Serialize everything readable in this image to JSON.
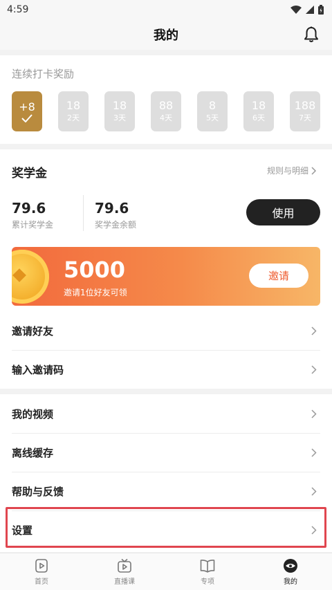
{
  "status": {
    "time": "4:59"
  },
  "header": {
    "title": "我的"
  },
  "checkin": {
    "label": "连续打卡奖励",
    "days": [
      {
        "points": "+8",
        "label": "",
        "active": true
      },
      {
        "points": "18",
        "label": "2天",
        "active": false
      },
      {
        "points": "18",
        "label": "3天",
        "active": false
      },
      {
        "points": "88",
        "label": "4天",
        "active": false
      },
      {
        "points": "8",
        "label": "5天",
        "active": false
      },
      {
        "points": "18",
        "label": "6天",
        "active": false
      },
      {
        "points": "188",
        "label": "7天",
        "active": false
      }
    ]
  },
  "scholarship": {
    "title": "奖学金",
    "rules_link": "规则与明细",
    "total_value": "79.6",
    "total_caption": "累计奖学金",
    "balance_value": "79.6",
    "balance_caption": "奖学金余额",
    "use_button": "使用",
    "invite_banner": {
      "amount": "5000",
      "description": "邀请1位好友可领",
      "button": "邀请"
    }
  },
  "menu": {
    "invite_friends": "邀请好友",
    "enter_code": "输入邀请码",
    "my_videos": "我的视频",
    "offline_cache": "离线缓存",
    "help_feedback": "帮助与反馈",
    "settings": "设置"
  },
  "tabbar": {
    "home": "首页",
    "live": "直播课",
    "topics": "专项",
    "mine": "我的"
  },
  "colors": {
    "accent_gold": "#b98b3e",
    "banner_start": "#f26a3d",
    "banner_end": "#f7b667",
    "highlight_red": "#e0464f"
  }
}
